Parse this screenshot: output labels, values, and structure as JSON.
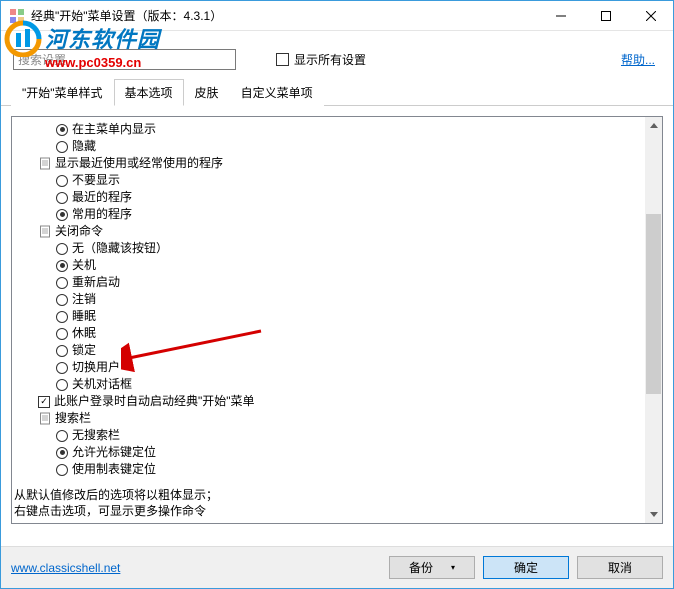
{
  "window": {
    "title": "经典\"开始\"菜单设置（版本：4.3.1）"
  },
  "watermark": {
    "text": "河东软件园",
    "url": "www.pc0359.cn"
  },
  "search": {
    "placeholder": "搜索设置"
  },
  "showAll": {
    "label": "显示所有设置",
    "checked": false
  },
  "helpLabel": "帮助...",
  "tabs": [
    {
      "label": "\"开始\"菜单样式"
    },
    {
      "label": "基本选项",
      "active": true
    },
    {
      "label": "皮肤"
    },
    {
      "label": "自定义菜单项"
    }
  ],
  "tree": [
    {
      "type": "radio",
      "indent": 2,
      "sel": true,
      "label": "在主菜单内显示"
    },
    {
      "type": "radio",
      "indent": 2,
      "sel": false,
      "label": "隐藏"
    },
    {
      "type": "group",
      "indent": 1,
      "label": "显示最近使用或经常使用的程序"
    },
    {
      "type": "radio",
      "indent": 2,
      "sel": false,
      "label": "不要显示"
    },
    {
      "type": "radio",
      "indent": 2,
      "sel": false,
      "label": "最近的程序"
    },
    {
      "type": "radio",
      "indent": 2,
      "sel": true,
      "label": "常用的程序"
    },
    {
      "type": "group",
      "indent": 1,
      "label": "关闭命令"
    },
    {
      "type": "radio",
      "indent": 2,
      "sel": false,
      "label": "无（隐藏该按钮）"
    },
    {
      "type": "radio",
      "indent": 2,
      "sel": true,
      "label": "关机"
    },
    {
      "type": "radio",
      "indent": 2,
      "sel": false,
      "label": "重新启动"
    },
    {
      "type": "radio",
      "indent": 2,
      "sel": false,
      "label": "注销"
    },
    {
      "type": "radio",
      "indent": 2,
      "sel": false,
      "label": "睡眠"
    },
    {
      "type": "radio",
      "indent": 2,
      "sel": false,
      "label": "休眠"
    },
    {
      "type": "radio",
      "indent": 2,
      "sel": false,
      "label": "锁定"
    },
    {
      "type": "radio",
      "indent": 2,
      "sel": false,
      "label": "切换用户"
    },
    {
      "type": "radio",
      "indent": 2,
      "sel": false,
      "label": "关机对话框"
    },
    {
      "type": "check",
      "indent": 1,
      "sel": true,
      "label": "此账户登录时自动启动经典\"开始\"菜单"
    },
    {
      "type": "group",
      "indent": 1,
      "label": "搜索栏"
    },
    {
      "type": "radio",
      "indent": 2,
      "sel": false,
      "label": "无搜索栏"
    },
    {
      "type": "radio",
      "indent": 2,
      "sel": true,
      "label": "允许光标键定位"
    },
    {
      "type": "radio",
      "indent": 2,
      "sel": false,
      "label": "使用制表键定位"
    }
  ],
  "hint": {
    "line1": "从默认值修改后的选项将以粗体显示；",
    "line2": "右键点击选项，可显示更多操作命令"
  },
  "footer": {
    "link": "www.classicshell.net",
    "backup": "备份",
    "ok": "确定",
    "cancel": "取消"
  }
}
